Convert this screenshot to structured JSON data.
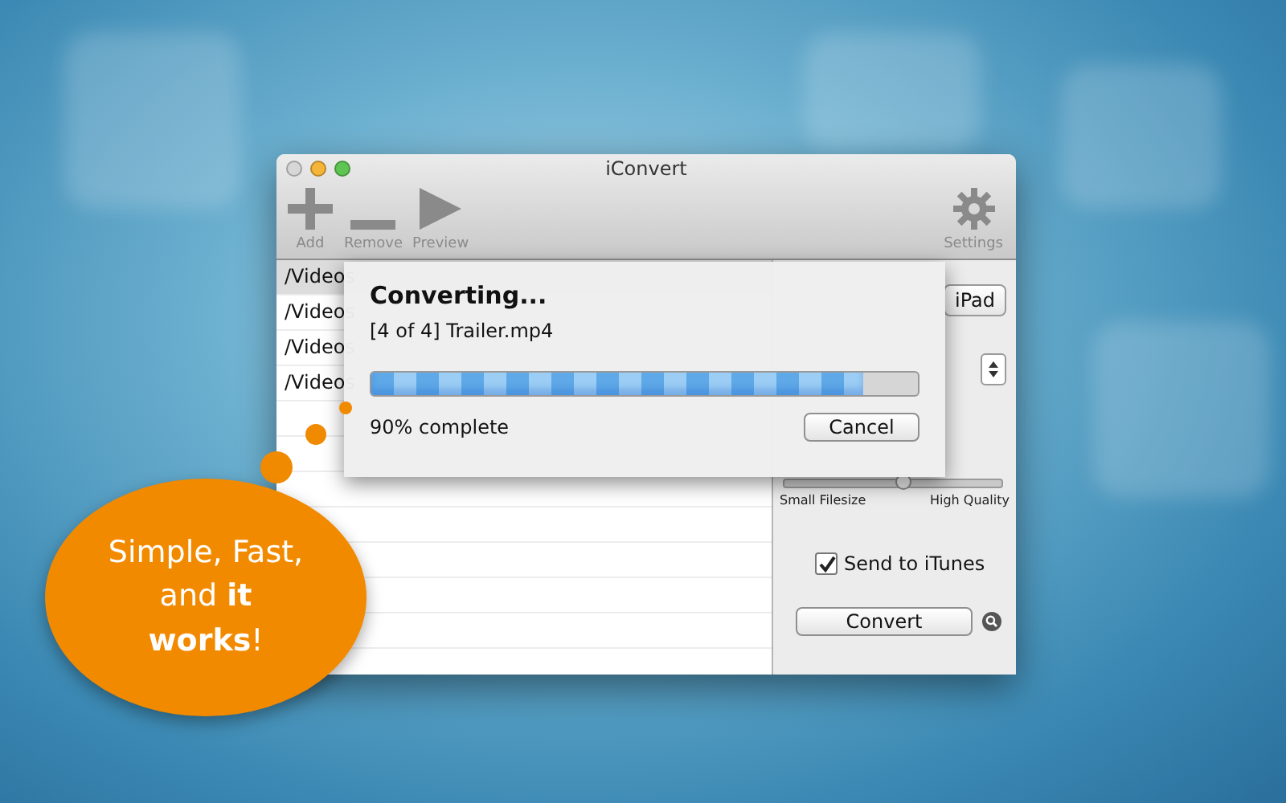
{
  "window": {
    "title": "iConvert"
  },
  "toolbar": [
    {
      "kind": "add",
      "label": "Add"
    },
    {
      "kind": "remove",
      "label": "Remove"
    },
    {
      "kind": "preview",
      "label": "Preview"
    },
    {
      "kind": "settings",
      "label": "Settings"
    }
  ],
  "files": [
    {
      "path": "/Videos",
      "selected": true
    },
    {
      "path": "/Videos",
      "selected": false
    },
    {
      "path": "/Videos",
      "selected": false
    },
    {
      "path": "/Videos",
      "selected": false
    }
  ],
  "device_segment": {
    "label": "iPad"
  },
  "quality_slider": {
    "level": 0.55
  },
  "quality_labels": [
    "Small Filesize",
    "High Quality"
  ],
  "send_to_itunes": {
    "label": "Send to iTunes",
    "checked": true
  },
  "convert_button": "Convert",
  "sheet": {
    "title": "Converting...",
    "file": "[4 of 4] Trailer.mp4",
    "level": 0.9,
    "status": "90% complete",
    "cancel": "Cancel"
  },
  "bubble": {
    "text": "Simple, Fast, and **it works**!"
  }
}
